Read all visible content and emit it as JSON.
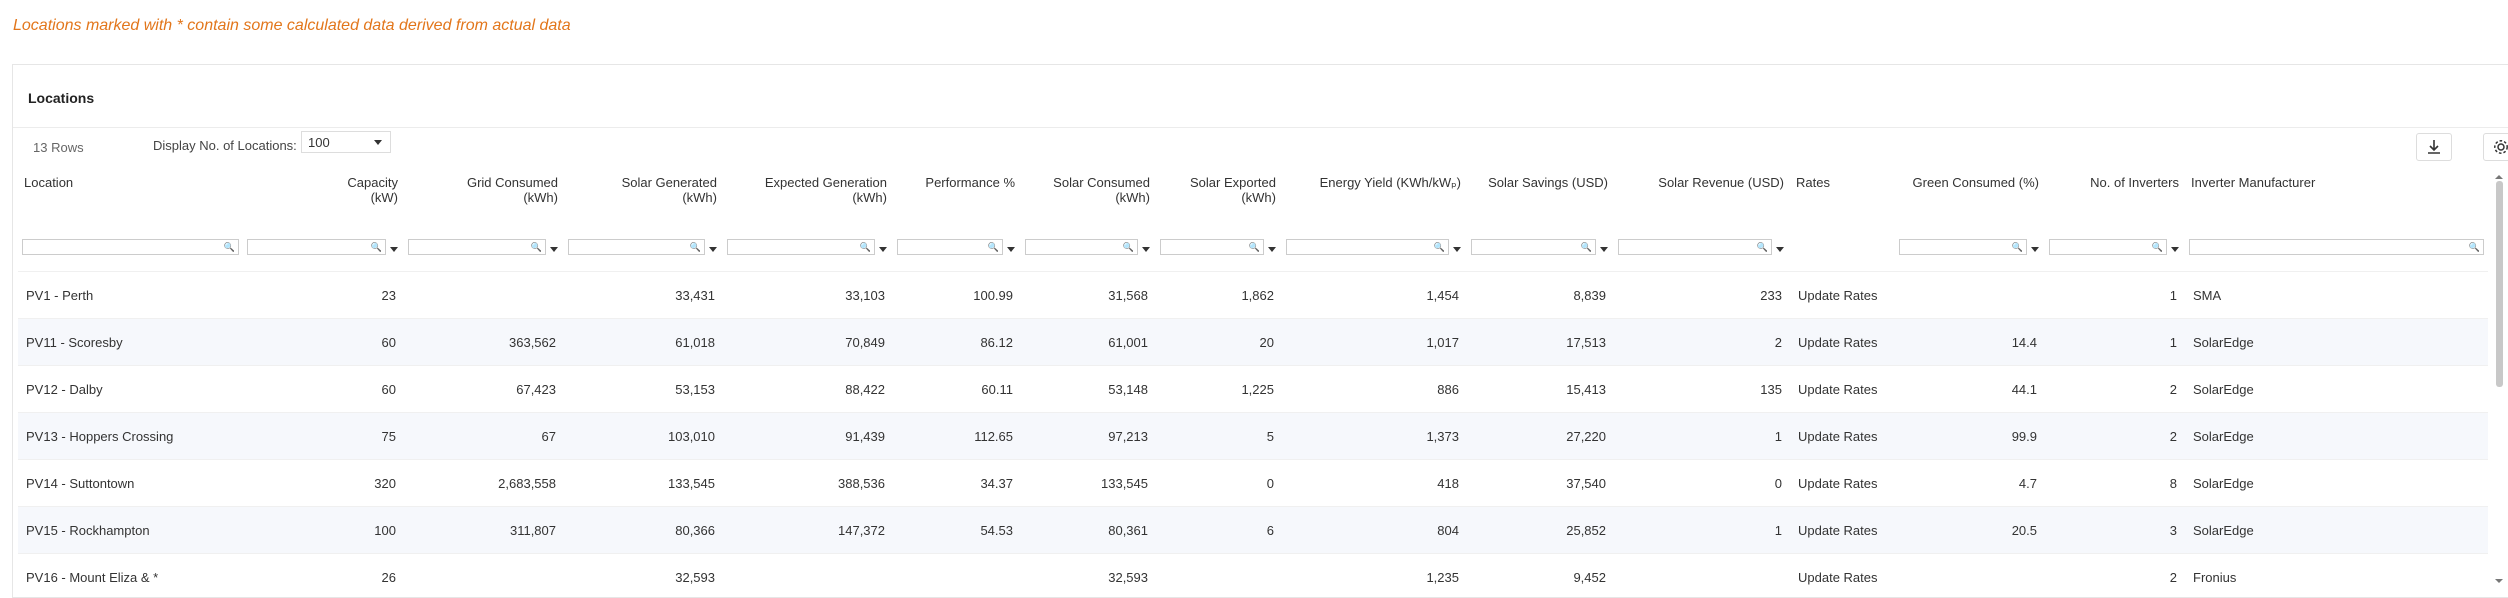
{
  "notice": "Locations marked with * contain some calculated data derived from actual data",
  "panel_title": "Locations",
  "rows_count": "13 Rows",
  "display_label": "Display No. of Locations:",
  "display_value": "100",
  "columns": [
    {
      "label1": "Location",
      "label2": ""
    },
    {
      "label1": "Capacity",
      "label2": "(kW)"
    },
    {
      "label1": "Grid Consumed",
      "label2": "(kWh)"
    },
    {
      "label1": "Solar Generated",
      "label2": "(kWh)"
    },
    {
      "label1": "Expected Generation",
      "label2": "(kWh)"
    },
    {
      "label1": "Performance %",
      "label2": ""
    },
    {
      "label1": "Solar Consumed",
      "label2": "(kWh)"
    },
    {
      "label1": "Solar Exported",
      "label2": "(kWh)"
    },
    {
      "label1": "Energy Yield (KWh/kWₚ)",
      "label2": ""
    },
    {
      "label1": "Solar Savings (USD)",
      "label2": ""
    },
    {
      "label1": "Solar Revenue (USD)",
      "label2": ""
    },
    {
      "label1": "Rates",
      "label2": ""
    },
    {
      "label1": "Green Consumed (%)",
      "label2": ""
    },
    {
      "label1": "No. of Inverters",
      "label2": ""
    },
    {
      "label1": "Inverter Manufacturer",
      "label2": ""
    }
  ],
  "rows": [
    [
      "PV1 - Perth",
      "23",
      "",
      "33,431",
      "33,103",
      "100.99",
      "31,568",
      "1,862",
      "1,454",
      "8,839",
      "233",
      "Update Rates",
      "",
      "1",
      "SMA"
    ],
    [
      "PV11 - Scoresby",
      "60",
      "363,562",
      "61,018",
      "70,849",
      "86.12",
      "61,001",
      "20",
      "1,017",
      "17,513",
      "2",
      "Update Rates",
      "14.4",
      "1",
      "SolarEdge"
    ],
    [
      "PV12 - Dalby",
      "60",
      "67,423",
      "53,153",
      "88,422",
      "60.11",
      "53,148",
      "1,225",
      "886",
      "15,413",
      "135",
      "Update Rates",
      "44.1",
      "2",
      "SolarEdge"
    ],
    [
      "PV13 - Hoppers Crossing",
      "75",
      "67",
      "103,010",
      "91,439",
      "112.65",
      "97,213",
      "5",
      "1,373",
      "27,220",
      "1",
      "Update Rates",
      "99.9",
      "2",
      "SolarEdge"
    ],
    [
      "PV14 - Suttontown",
      "320",
      "2,683,558",
      "133,545",
      "388,536",
      "34.37",
      "133,545",
      "0",
      "418",
      "37,540",
      "0",
      "Update Rates",
      "4.7",
      "8",
      "SolarEdge"
    ],
    [
      "PV15 - Rockhampton",
      "100",
      "311,807",
      "80,366",
      "147,372",
      "54.53",
      "80,361",
      "6",
      "804",
      "25,852",
      "1",
      "Update Rates",
      "20.5",
      "3",
      "SolarEdge"
    ],
    [
      "PV16 - Mount Eliza & *",
      "26",
      "",
      "32,593",
      "",
      "",
      "32,593",
      "",
      "1,235",
      "9,452",
      "",
      "Update Rates",
      "",
      "2",
      "Fronius"
    ]
  ]
}
